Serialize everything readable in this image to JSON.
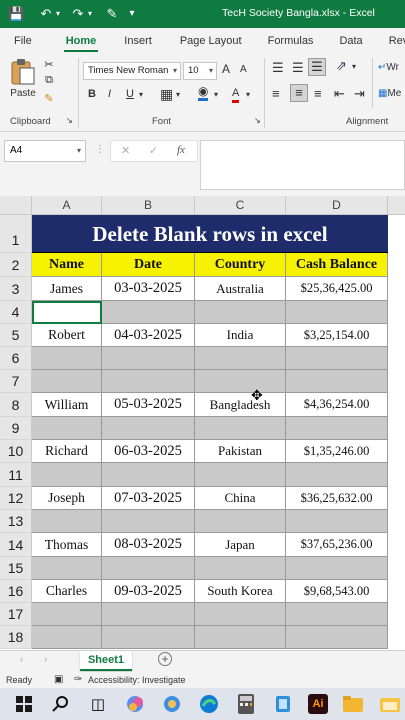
{
  "titlebar": {
    "title": "TecH Society Bangla.xlsx  -  Excel",
    "icons": [
      "save-icon",
      "undo-icon",
      "redo-icon",
      "touch-mode-icon"
    ]
  },
  "ribbon_tabs": [
    "File",
    "Home",
    "Insert",
    "Page Layout",
    "Formulas",
    "Data",
    "Review"
  ],
  "active_tab": "Home",
  "clipboard": {
    "paste_label": "Paste",
    "group_label": "Clipboard"
  },
  "font": {
    "font_name": "Times New Roman",
    "font_size": "10",
    "grow": "A",
    "shrink": "A",
    "bold": "B",
    "italic": "I",
    "underline": "U",
    "font_color_letter": "A",
    "group_label": "Font"
  },
  "alignment": {
    "group_label": "Alignment",
    "wrap_label": "Wr",
    "merge_label": "Me"
  },
  "formula_bar": {
    "name_box": "A4",
    "fx": "fx",
    "cancel": "✕",
    "enter": "✓"
  },
  "columns": [
    "A",
    "B",
    "C",
    "D"
  ],
  "sheet": {
    "title": "Delete Blank rows in excel",
    "headers": [
      "Name",
      "Date",
      "Country",
      "Cash Balance"
    ],
    "rows": [
      {
        "row": "3",
        "name": "James",
        "date": "03-03-2025",
        "country": "Australia",
        "cash": "$25,36,425.00"
      },
      {
        "row": "4",
        "name": "",
        "date": "",
        "country": "",
        "cash": ""
      },
      {
        "row": "5",
        "name": "Robert",
        "date": "04-03-2025",
        "country": "India",
        "cash": "$3,25,154.00"
      },
      {
        "row": "6",
        "name": "",
        "date": "",
        "country": "",
        "cash": ""
      },
      {
        "row": "7",
        "name": "",
        "date": "",
        "country": "",
        "cash": ""
      },
      {
        "row": "8",
        "name": "William",
        "date": "05-03-2025",
        "country": "Bangladesh",
        "cash": "$4,36,254.00"
      },
      {
        "row": "9",
        "name": "",
        "date": "",
        "country": "",
        "cash": ""
      },
      {
        "row": "10",
        "name": "Richard",
        "date": "06-03-2025",
        "country": "Pakistan",
        "cash": "$1,35,246.00"
      },
      {
        "row": "11",
        "name": "",
        "date": "",
        "country": "",
        "cash": ""
      },
      {
        "row": "12",
        "name": "Joseph",
        "date": "07-03-2025",
        "country": "China",
        "cash": "$36,25,632.00"
      },
      {
        "row": "13",
        "name": "",
        "date": "",
        "country": "",
        "cash": ""
      },
      {
        "row": "14",
        "name": "Thomas",
        "date": "08-03-2025",
        "country": "Japan",
        "cash": "$37,65,236.00"
      },
      {
        "row": "15",
        "name": "",
        "date": "",
        "country": "",
        "cash": ""
      },
      {
        "row": "16",
        "name": "Charles",
        "date": "09-03-2025",
        "country": "South Korea",
        "cash": "$9,68,543.00"
      },
      {
        "row": "17",
        "name": "",
        "date": "",
        "country": "",
        "cash": ""
      },
      {
        "row": "18",
        "name": "",
        "date": "",
        "country": "",
        "cash": ""
      }
    ]
  },
  "sheet_tab": "Sheet1",
  "status": {
    "ready": "Ready",
    "accessibility": "Accessibility: Investigate"
  },
  "taskbar_icons": [
    "windows-start-icon",
    "search-icon",
    "task-view-icon",
    "copilot-icon",
    "photos-icon",
    "edge-icon",
    "calculator-icon",
    "notes-icon",
    "illustrator-icon",
    "file-explorer-icon",
    "folder-icon"
  ],
  "colors": {
    "excel_green": "#0f7b41",
    "title_bg": "#1f2c6b",
    "header_yellow": "#f7f300",
    "blank_gray": "#c9c9c9"
  }
}
